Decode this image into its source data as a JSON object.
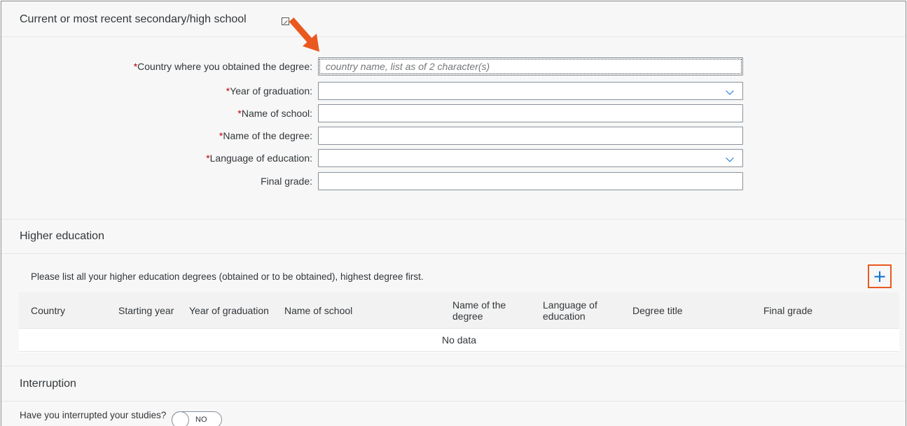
{
  "secondary": {
    "title": "Current or most recent secondary/high school",
    "fields": [
      {
        "label": "Country where you obtained the degree:",
        "required": true,
        "type": "text",
        "placeholder": "country name, list as of 2 character(s)",
        "value": ""
      },
      {
        "label": "Year of graduation:",
        "required": true,
        "type": "select",
        "value": ""
      },
      {
        "label": "Name of school:",
        "required": true,
        "type": "text",
        "value": ""
      },
      {
        "label": "Name of the degree:",
        "required": true,
        "type": "text",
        "value": ""
      },
      {
        "label": "Language of education:",
        "required": true,
        "type": "select",
        "value": ""
      },
      {
        "label": "Final grade:",
        "required": false,
        "type": "text",
        "value": ""
      }
    ],
    "required_marker": "*"
  },
  "higher": {
    "title": "Higher education",
    "help": "Please list all your higher education degrees (obtained or to be obtained), highest degree first.",
    "add_label": "+",
    "columns": [
      "Country",
      "Starting year",
      "Year of graduation",
      "Name of school",
      "Name of the degree",
      "Language of education",
      "Degree title",
      "Final grade"
    ],
    "empty_text": "No data"
  },
  "interruption": {
    "title": "Interruption",
    "question": "Have you interrupted your studies?",
    "toggle_label": "NO"
  },
  "icons": {
    "edit": "edit-icon",
    "arrow": "arrow-annotation-icon",
    "chevron": "chevron-down-icon",
    "add": "add-icon"
  },
  "colors": {
    "required": "#bb0000",
    "accent": "#0a6ed1",
    "annotation": "#e9591f"
  }
}
